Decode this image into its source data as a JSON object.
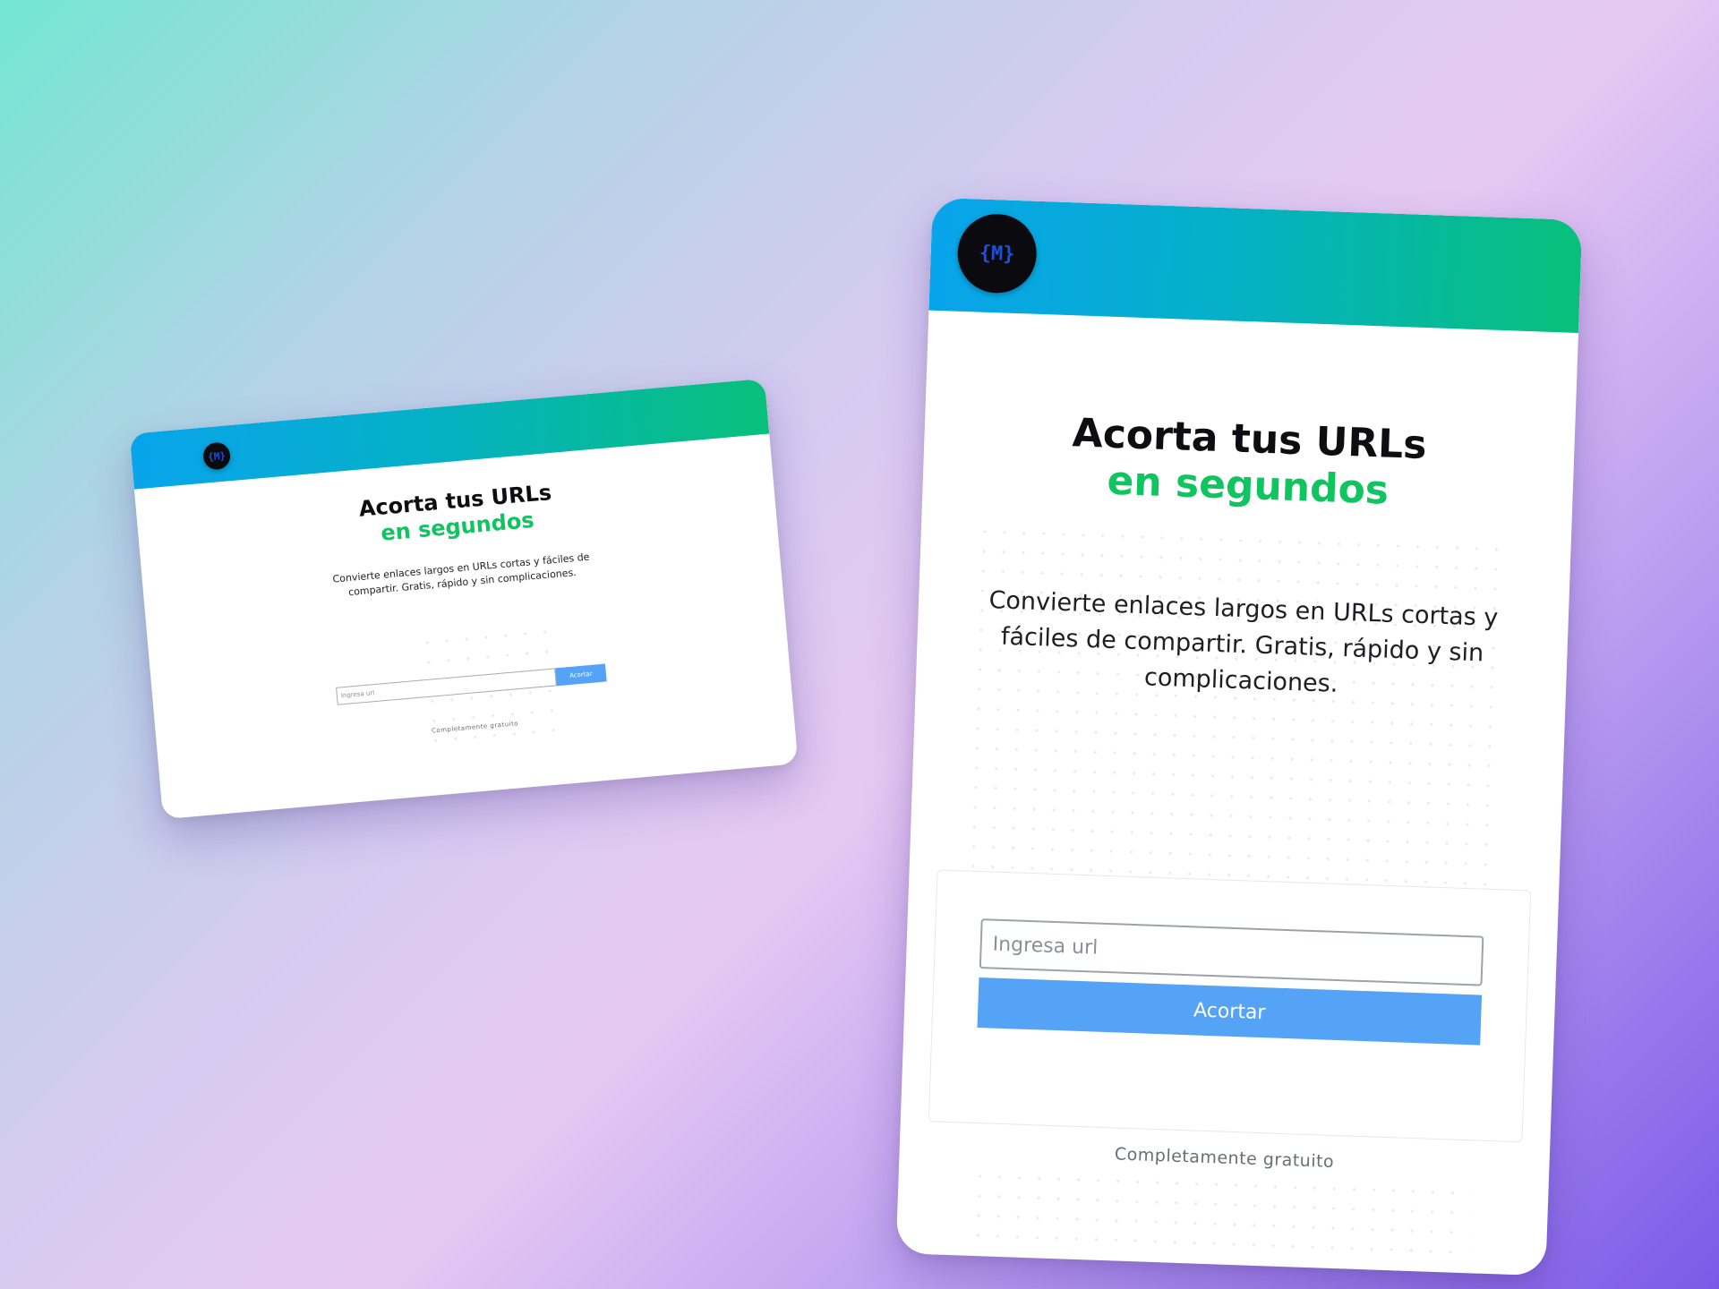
{
  "brand": {
    "logo_glyph": "{M}",
    "header_gradient": [
      "#08a4ec",
      "#08c07a"
    ],
    "accent_green": "#10c45f",
    "button_color": "#55a3f7"
  },
  "hero": {
    "title_line1": "Acorta tus URLs",
    "title_line2": "en segundos",
    "description": "Convierte enlaces largos en URLs cortas y fáciles de compartir. Gratis, rápido y sin complicaciones."
  },
  "form": {
    "input_placeholder": "Ingresa url",
    "input_value": "",
    "submit_label": "Acortar"
  },
  "footer": {
    "note": "Completamente gratuito"
  }
}
